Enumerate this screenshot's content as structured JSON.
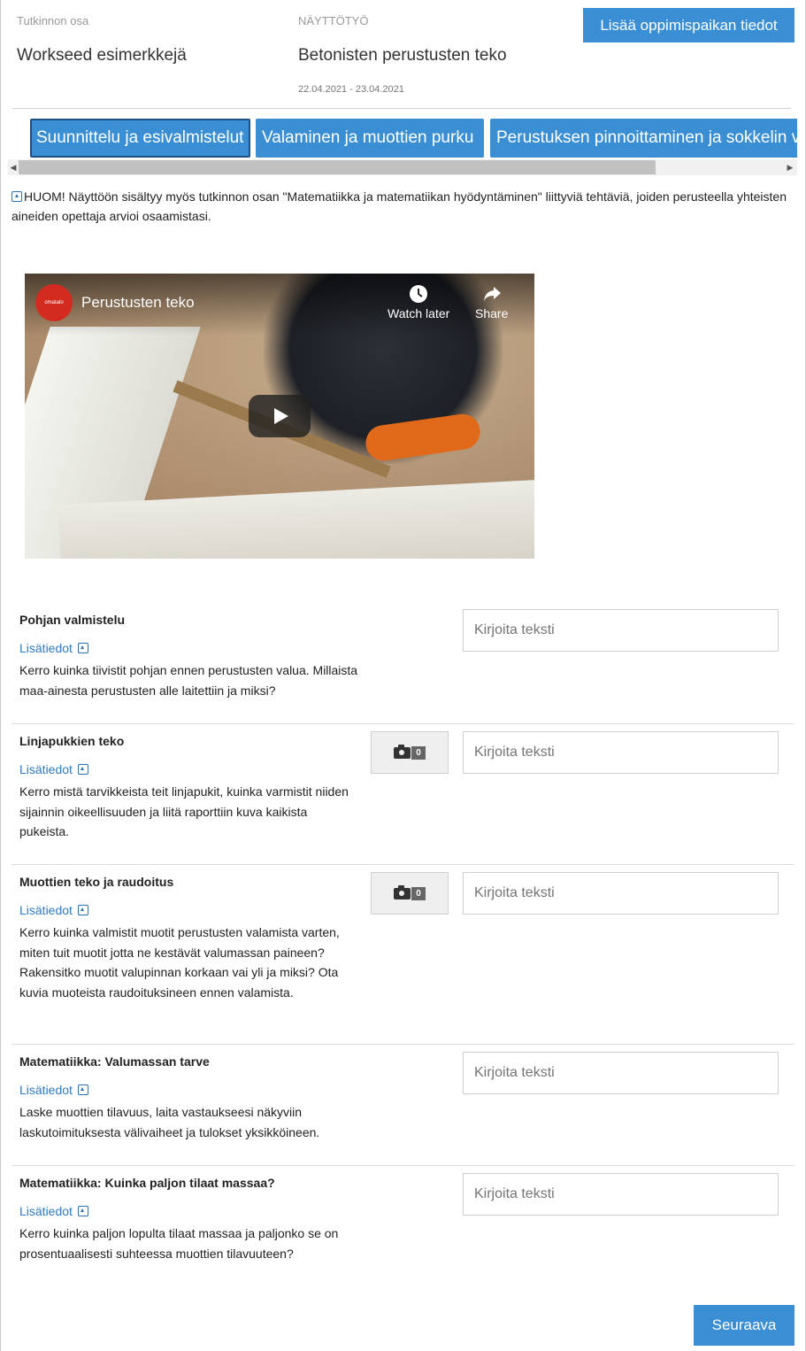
{
  "header": {
    "unit_label": "Tutkinnon osa",
    "unit_value": "Workseed esimerkkejä",
    "demo_label": "NÄYTTÖTYÖ",
    "demo_value": "Betonisten perustusten teko",
    "dates": "22.04.2021 - 23.04.2021",
    "add_workplace_button": "Lisää oppimispaikan tiedot"
  },
  "tabs": [
    {
      "label": "Suunnittelu ja esivalmistelut",
      "active": true
    },
    {
      "label": "Valaminen ja muottien purku",
      "active": false
    },
    {
      "label": "Perustuksen pinnoittaminen ja sokkelin viimeistely",
      "active": false
    }
  ],
  "note": "HUOM! Näyttöön sisältyy myös tutkinnon osan \"Matematiikka ja matematiikan hyödyntäminen\" liittyviä tehtäviä, joiden perusteella yhteisten aineiden opettaja arvioi osaamistasi.",
  "video": {
    "channel_logo": "omatalo",
    "title": "Perustusten teko",
    "watch_later": "Watch later",
    "share": "Share"
  },
  "tasks": [
    {
      "title": "Pohjan valmistelu",
      "more_label": "Lisätiedot",
      "description": "Kerro kuinka tiivistit pohjan ennen perustusten valua. Millaista maa-ainesta perustusten alle laitettiin ja miksi?",
      "placeholder": "Kirjoita teksti",
      "has_camera": false,
      "photo_count": ""
    },
    {
      "title": "Linjapukkien teko",
      "more_label": "Lisätiedot",
      "description": "Kerro mistä tarvikkeista teit linjapukit, kuinka varmistit niiden sijainnin oikeellisuuden ja liitä raporttiin kuva kaikista pukeista.",
      "placeholder": "Kirjoita teksti",
      "has_camera": true,
      "photo_count": "0"
    },
    {
      "title": "Muottien teko ja raudoitus",
      "more_label": "Lisätiedot",
      "description": "Kerro kuinka valmistit muotit perustusten valamista varten, miten tuit muotit jotta ne kestävät valumassan paineen? Rakensitko muotit valupinnan korkaan vai yli ja miksi? Ota kuvia muoteista raudoituksineen ennen valamista.",
      "placeholder": "Kirjoita teksti",
      "has_camera": true,
      "photo_count": "0"
    },
    {
      "title": "Matematiikka: Valumassan tarve",
      "more_label": "Lisätiedot",
      "description": "Laske muottien tilavuus, laita vastaukseesi näkyviin laskutoimituksesta välivaiheet ja tulokset yksikköineen.",
      "placeholder": "Kirjoita teksti",
      "has_camera": false,
      "photo_count": ""
    },
    {
      "title": "Matematiikka: Kuinka paljon tilaat massaa?",
      "more_label": "Lisätiedot",
      "description": "Kerro kuinka paljon lopulta tilaat massaa ja paljonko se on prosentuaalisesti suhteessa muottien tilavuuteen?",
      "placeholder": "Kirjoita teksti",
      "has_camera": false,
      "photo_count": ""
    }
  ],
  "next_button": "Seuraava",
  "colors": {
    "primary": "#3a8fd4",
    "link": "#2e7bc4"
  }
}
